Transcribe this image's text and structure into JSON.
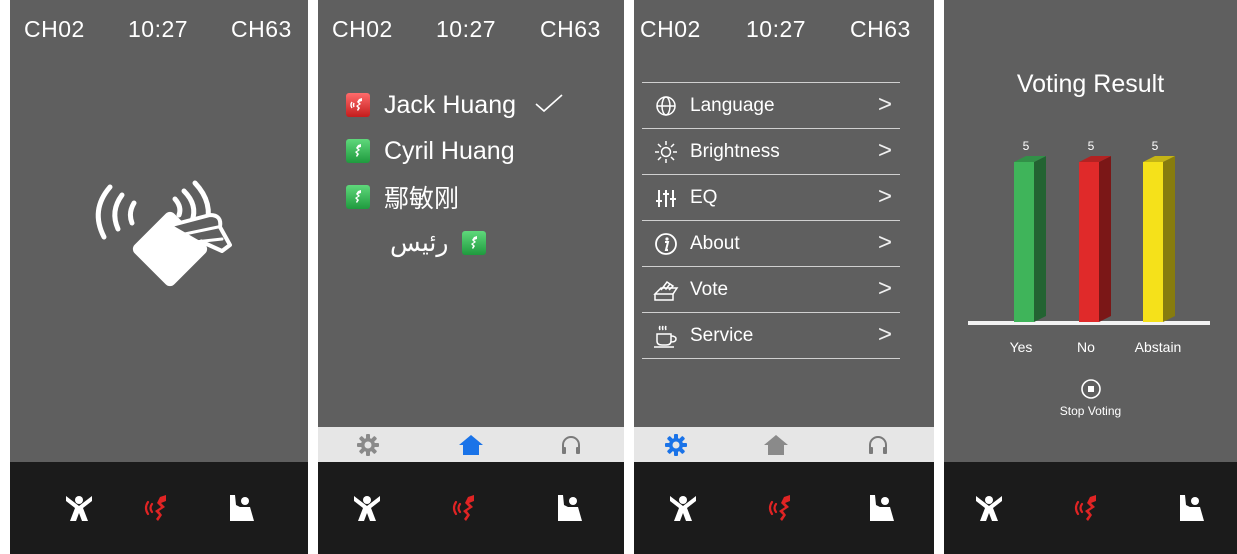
{
  "status": {
    "left_channel": "CH02",
    "time": "10:27",
    "right_channel": "CH63"
  },
  "bottom_bar": {
    "buttons": [
      "arms-up-person-icon",
      "speaking-mic-icon",
      "hand-raise-person-icon"
    ],
    "active_color": "#e02424"
  },
  "tab_bar": {
    "tabs": [
      "settings-gear-icon",
      "home-icon",
      "headphones-icon"
    ]
  },
  "screen1": {
    "icon": "nfc-card-tap-icon"
  },
  "screen2": {
    "participants": [
      {
        "name": "Jack Huang",
        "status": "speaking",
        "color": "#d83030",
        "selected": true
      },
      {
        "name": "Cyril Huang",
        "status": "idle",
        "color": "#2eaa4e",
        "selected": false
      },
      {
        "name": "鄢敏刚",
        "status": "idle",
        "color": "#2eaa4e",
        "selected": false
      },
      {
        "name": "رئيس",
        "status": "idle",
        "color": "#2eaa4e",
        "selected": false
      }
    ],
    "active_tab": "home"
  },
  "screen3": {
    "menu": [
      {
        "label": "Language",
        "icon": "globe-icon",
        "arrow": ">"
      },
      {
        "label": "Brightness",
        "icon": "sun-icon",
        "arrow": ">"
      },
      {
        "label": "EQ",
        "icon": "equalizer-sliders-icon",
        "arrow": ">"
      },
      {
        "label": "About",
        "icon": "info-icon",
        "arrow": ">"
      },
      {
        "label": "Vote",
        "icon": "ballot-box-icon",
        "arrow": ">"
      },
      {
        "label": "Service",
        "icon": "coffee-cup-icon",
        "arrow": ">"
      }
    ],
    "active_tab": "settings"
  },
  "screen4": {
    "title": "Voting Result",
    "stop_label": "Stop Voting"
  },
  "chart_data": {
    "type": "bar",
    "title": "Voting Result",
    "categories": [
      "Yes",
      "No",
      "Abstain"
    ],
    "values": [
      5,
      5,
      5
    ],
    "colors": [
      "#3fb45a",
      "#e02a2a",
      "#f5e11a"
    ],
    "xlabel": "",
    "ylabel": "",
    "grid": false
  }
}
